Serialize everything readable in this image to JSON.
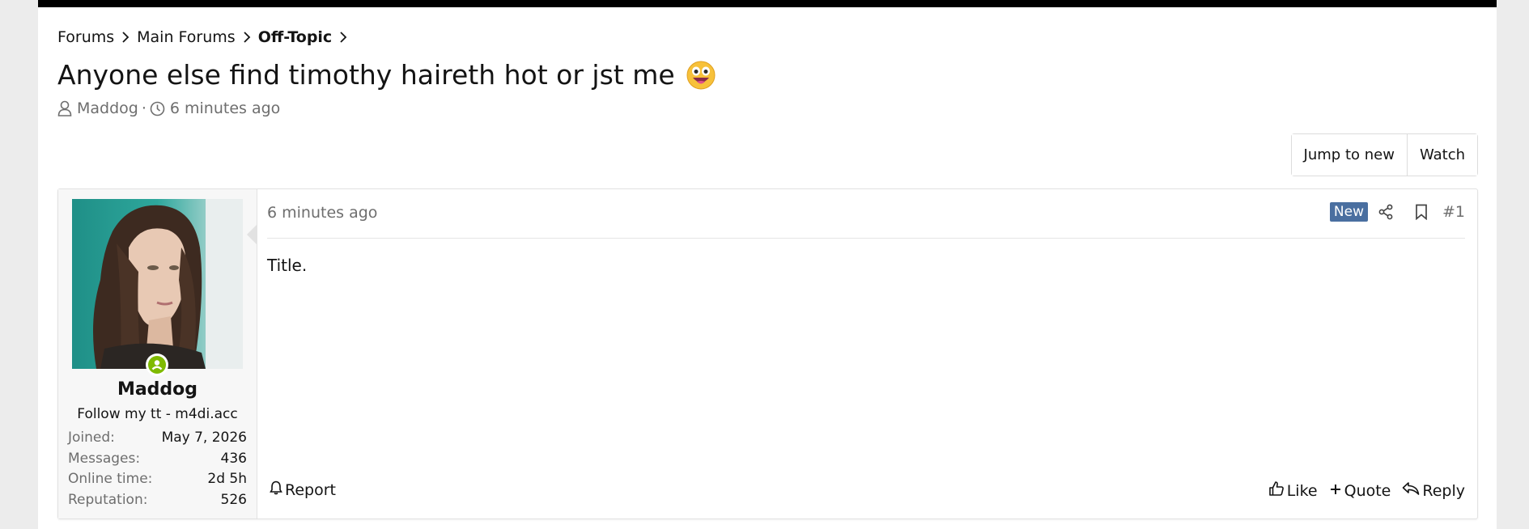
{
  "breadcrumb": {
    "items": [
      {
        "label": "Forums"
      },
      {
        "label": "Main Forums"
      },
      {
        "label": "Off-Topic"
      }
    ]
  },
  "thread": {
    "title": "Anyone else find timothy haireth hot or jst me",
    "author": "Maddog",
    "separator": "·",
    "started": "6 minutes ago"
  },
  "toolbar": {
    "jump_label": "Jump to new",
    "watch_label": "Watch"
  },
  "post": {
    "time": "6 minutes ago",
    "badge": "New",
    "number": "#1",
    "body": "Title.",
    "user": {
      "name": "Maddog",
      "title": "Follow my tt - m4di.acc",
      "stats": [
        {
          "label": "Joined:",
          "value": "May 7, 2026"
        },
        {
          "label": "Messages:",
          "value": "436"
        },
        {
          "label": "Online time:",
          "value": "2d 5h"
        },
        {
          "label": "Reputation:",
          "value": "526"
        }
      ]
    },
    "footer": {
      "report": "Report",
      "like": "Like",
      "quote": "Quote",
      "reply": "Reply"
    }
  },
  "colors": {
    "topbar": "#000000",
    "badge": "#4a6fa0",
    "online": "#7fba00",
    "muted": "#6e6e6e"
  },
  "icons": [
    "chevron-right-icon",
    "grinning-emoji-icon",
    "user-icon",
    "clock-icon",
    "share-icon",
    "bookmark-icon",
    "bell-icon",
    "thumbs-up-icon",
    "plus-icon",
    "reply-icon",
    "online-status-icon"
  ]
}
